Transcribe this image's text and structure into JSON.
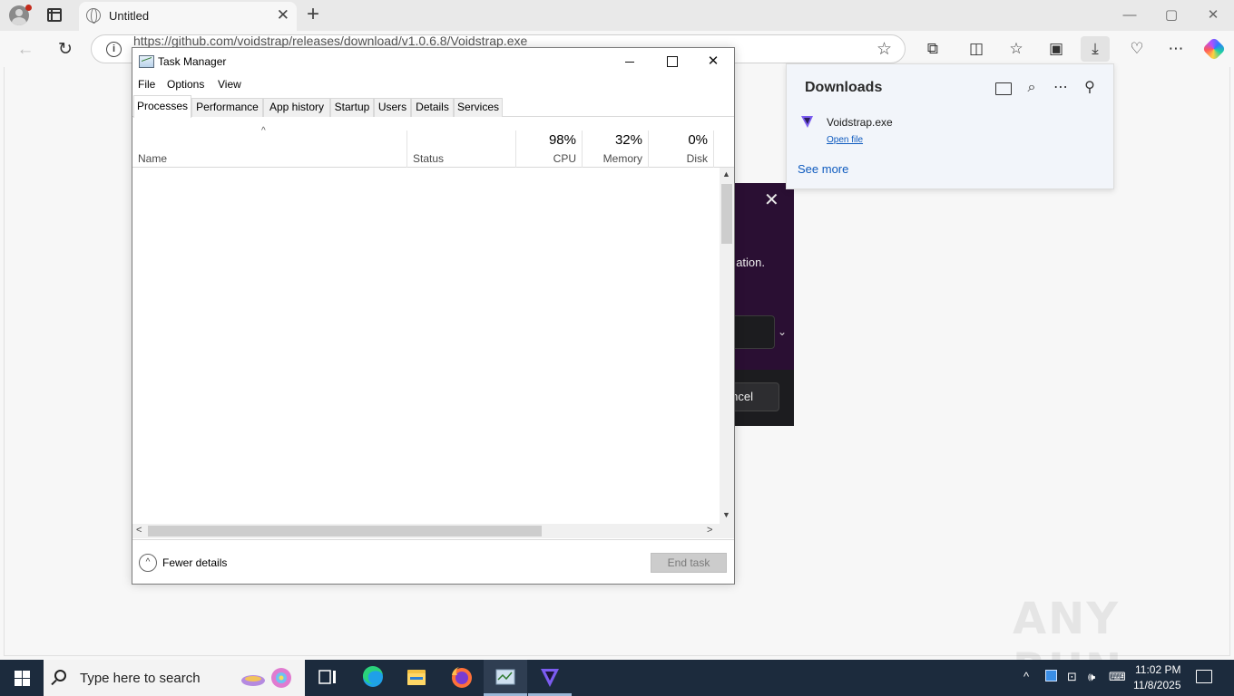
{
  "browser": {
    "tab_title": "Untitled",
    "url": "https://github.com/voidstrap/releases/download/v1.0.6.8/Voidstrap.exe",
    "win_minimize": "—",
    "win_restore": "▢",
    "win_close": "✕"
  },
  "downloads": {
    "title": "Downloads",
    "file_name": "Voidstrap.exe",
    "open_file": "Open file",
    "see_more": "See more"
  },
  "installer": {
    "text": "ation.",
    "cancel_label": "ncel"
  },
  "task_manager": {
    "title": "Task Manager",
    "menu": [
      "File",
      "Options",
      "View"
    ],
    "tabs": [
      "Processes",
      "Performance",
      "App history",
      "Startup",
      "Users",
      "Details",
      "Services"
    ],
    "columns": {
      "name": "Name",
      "status": "Status",
      "cpu": {
        "percent": "98%",
        "label": "CPU"
      },
      "memory": {
        "percent": "32%",
        "label": "Memory"
      },
      "disk": {
        "percent": "0%",
        "label": "Disk"
      }
    },
    "fewer_details": "Fewer details",
    "end_task": "End task"
  },
  "watermark": "ANY RUN",
  "taskbar": {
    "search_placeholder": "Type here to search",
    "time": "11:02 PM",
    "date": "11/8/2025"
  },
  "colors": {
    "taskbar": "#1c2b3d",
    "installer": "#2a0f33",
    "link": "#0f5bbf"
  }
}
